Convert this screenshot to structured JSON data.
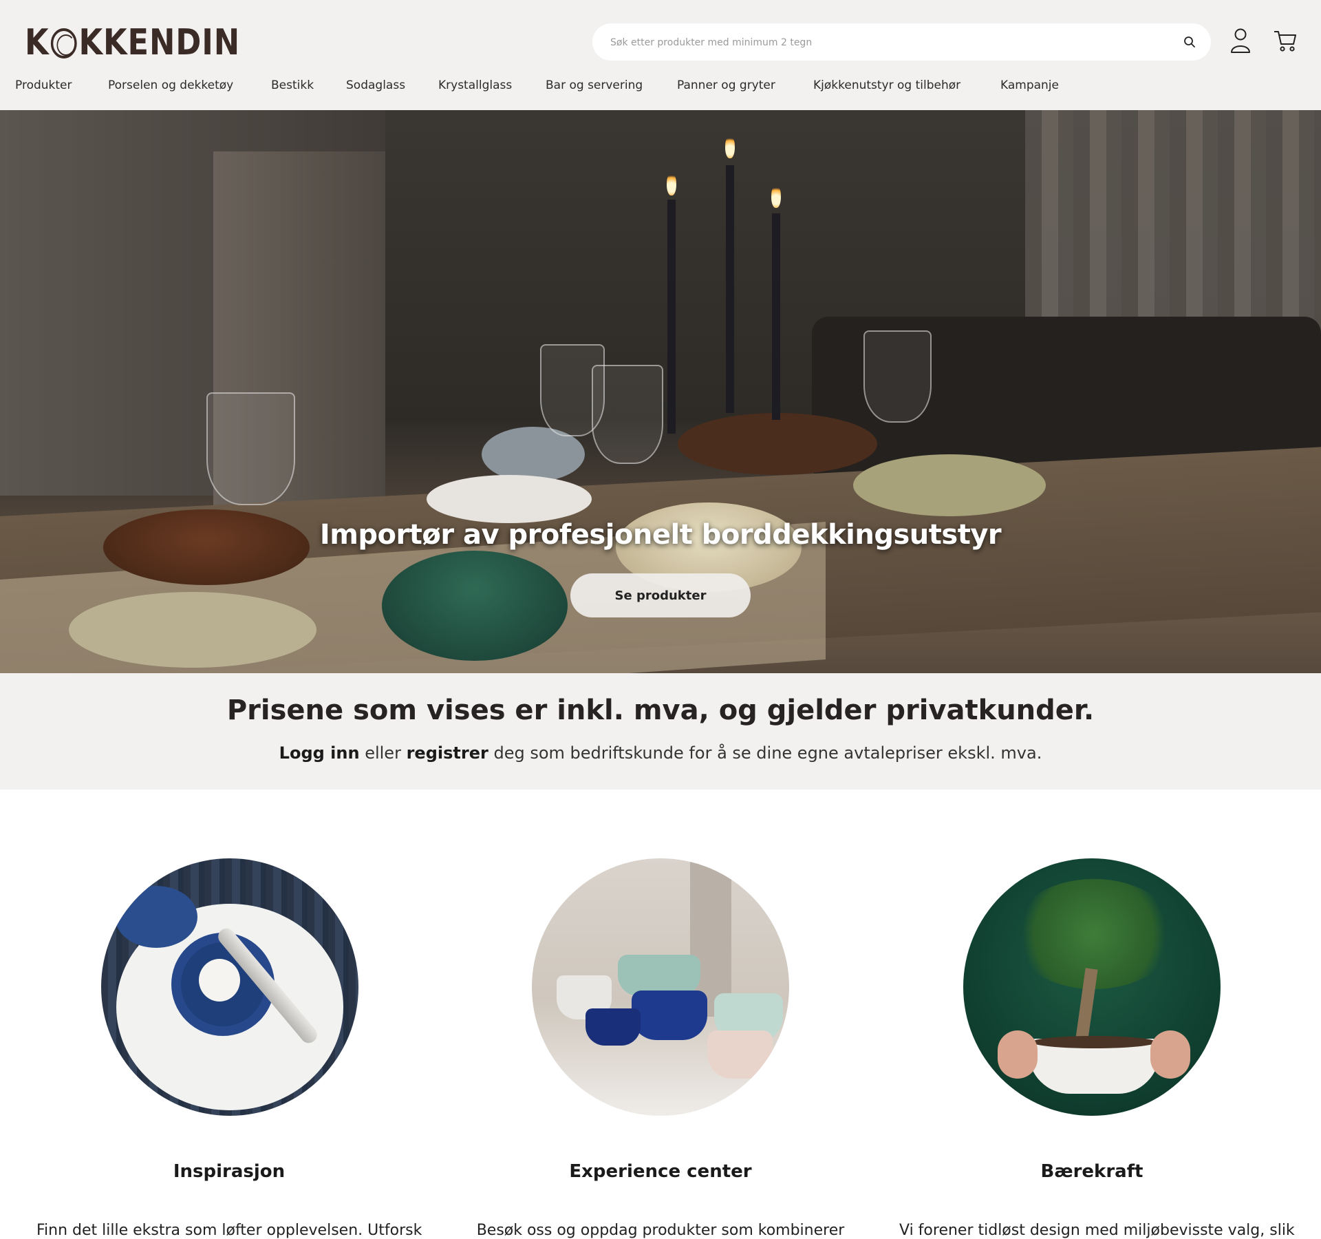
{
  "header": {
    "logo_text": "KOKKENDIN",
    "search_placeholder": "Søk etter produkter med minimum 2 tegn",
    "icons": {
      "search": "search-icon",
      "account": "user-icon",
      "cart": "cart-icon"
    }
  },
  "nav": {
    "items": [
      {
        "label": "Produkter"
      },
      {
        "label": "Porselen og dekketøy"
      },
      {
        "label": "Bestikk"
      },
      {
        "label": "Sodaglass"
      },
      {
        "label": "Krystallglass"
      },
      {
        "label": "Bar og servering"
      },
      {
        "label": "Panner og gryter"
      },
      {
        "label": "Kjøkkenutstyr og tilbehør"
      },
      {
        "label": "Kampanje"
      }
    ]
  },
  "hero": {
    "title": "Importør av profesjonelt borddekkingsutstyr",
    "button_label": "Se produkter"
  },
  "notice": {
    "heading": "Prisene som vises er inkl. mva, og gjelder privatkunder.",
    "login_label": "Logg inn",
    "or_text": "eller",
    "register_label": "registrer",
    "rest_text": "deg som bedriftskunde for å se dine egne avtalepriser ekskl. mva."
  },
  "cards": [
    {
      "title": "Inspirasjon",
      "text": "Finn det lille ekstra som løfter opplevelsen. Utforsk"
    },
    {
      "title": "Experience center",
      "text": "Besøk oss og oppdag produkter som kombinerer"
    },
    {
      "title": "Bærekraft",
      "text": "Vi forener tidløst design med miljøbevisste valg, slik"
    }
  ],
  "colors": {
    "header_bg": "#f3f1ef",
    "logo": "#3b2b27",
    "text": "#1a1a1a"
  }
}
